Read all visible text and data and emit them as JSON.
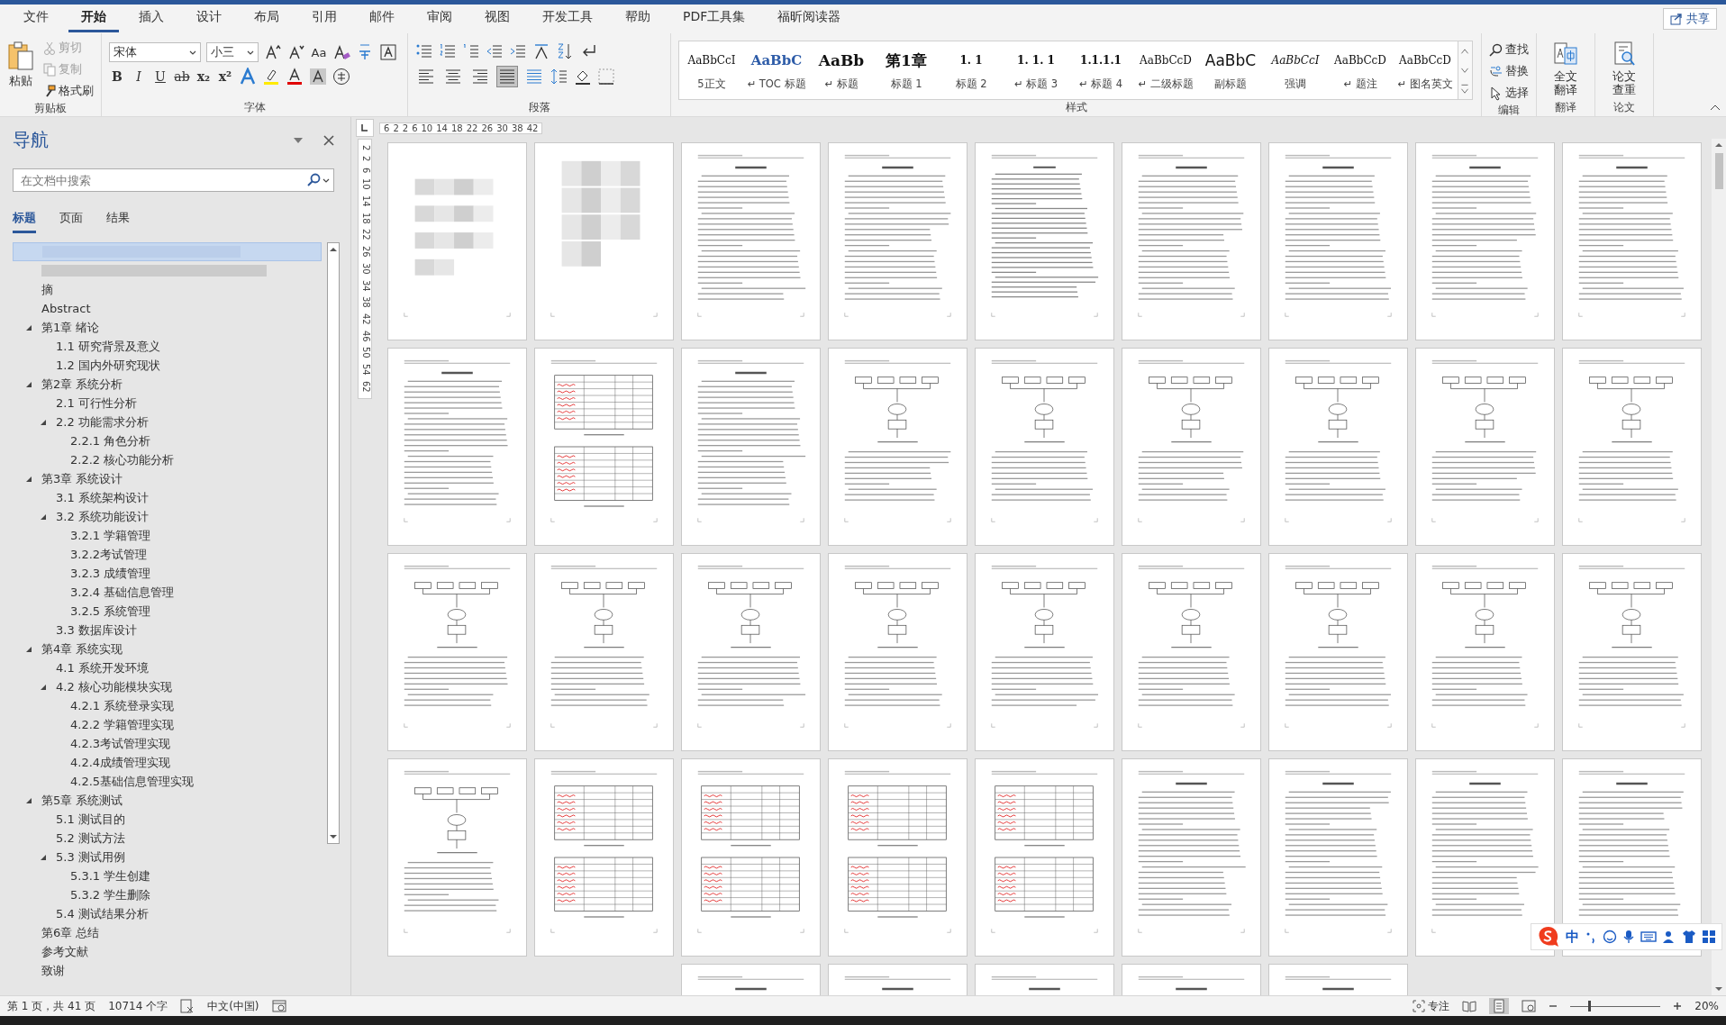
{
  "window": {
    "share_button": "共享"
  },
  "menu_tabs": [
    {
      "label": "文件",
      "selected": false
    },
    {
      "label": "开始",
      "selected": true
    },
    {
      "label": "插入",
      "selected": false
    },
    {
      "label": "设计",
      "selected": false
    },
    {
      "label": "布局",
      "selected": false
    },
    {
      "label": "引用",
      "selected": false
    },
    {
      "label": "邮件",
      "selected": false
    },
    {
      "label": "审阅",
      "selected": false
    },
    {
      "label": "视图",
      "selected": false
    },
    {
      "label": "开发工具",
      "selected": false
    },
    {
      "label": "帮助",
      "selected": false
    },
    {
      "label": "PDF工具集",
      "selected": false
    },
    {
      "label": "福昕阅读器",
      "selected": false
    }
  ],
  "ribbon": {
    "clipboard": {
      "label": "剪贴板",
      "paste": "粘贴",
      "items": [
        {
          "label": "剪切",
          "kind": "cut",
          "disabled": true
        },
        {
          "label": "复制",
          "kind": "copy",
          "disabled": true
        },
        {
          "label": "格式刷",
          "kind": "painter",
          "disabled": false
        }
      ]
    },
    "font": {
      "label": "字体",
      "name": "宋体",
      "size": "小三",
      "case_button": "Aa",
      "buttons": [
        {
          "label": "B",
          "kind": "bold"
        },
        {
          "label": "I",
          "kind": "italic"
        },
        {
          "label": "U",
          "kind": "underline"
        },
        {
          "label": "ab",
          "kind": "strike"
        },
        {
          "label": "x₂",
          "kind": "sub"
        },
        {
          "label": "x²",
          "kind": "sup"
        }
      ]
    },
    "paragraph": {
      "label": "段落",
      "alignments": [
        {
          "kind": "left",
          "selected": false
        },
        {
          "kind": "center",
          "selected": false
        },
        {
          "kind": "right",
          "selected": false
        },
        {
          "kind": "justify",
          "selected": true
        },
        {
          "kind": "distributed",
          "selected": false
        }
      ]
    },
    "styles": {
      "label": "样式",
      "items": [
        {
          "preview": "AaBbCcI",
          "name": "5正文",
          "kind": "normal"
        },
        {
          "preview": "AaBbC",
          "name": "↵ TOC 标题",
          "kind": "toc"
        },
        {
          "preview": "AaBb",
          "name": "↵ 标题",
          "kind": "title"
        },
        {
          "preview": "第1章",
          "name": "标题 1",
          "kind": "title"
        },
        {
          "preview": "1. 1",
          "name": "标题 2",
          "kind": "heading"
        },
        {
          "preview": "1. 1. 1",
          "name": "↵ 标题 3",
          "kind": "heading"
        },
        {
          "preview": "1.1.1.1",
          "name": "↵ 标题 4",
          "kind": "heading"
        },
        {
          "preview": "AaBbCcD",
          "name": "↵ 二级标题",
          "kind": "normal"
        },
        {
          "preview": "AaBbC",
          "name": "副标题",
          "kind": "subtitle"
        },
        {
          "preview": "AaBbCcI",
          "name": "强调",
          "kind": "emphasis"
        },
        {
          "preview": "AaBbCcD",
          "name": "↵ 题注",
          "kind": "normal"
        },
        {
          "preview": "AaBbCcD",
          "name": "↵ 图名英文",
          "kind": "normal"
        }
      ]
    },
    "editing": {
      "label": "编辑",
      "items": [
        {
          "label": "查找",
          "kind": "find"
        },
        {
          "label": "替换",
          "kind": "replace"
        },
        {
          "label": "选择",
          "kind": "select"
        }
      ]
    },
    "translate": {
      "label": "翻译",
      "button": "全文翻译"
    },
    "thesis": {
      "label": "论文",
      "button": "论文查重"
    }
  },
  "navigation": {
    "title": "导航",
    "search": {
      "placeholder": "在文档中搜索"
    },
    "tabs": [
      {
        "label": "标题",
        "selected": true
      },
      {
        "label": "页面",
        "selected": false
      },
      {
        "label": "结果",
        "selected": false
      }
    ],
    "items": [
      {
        "kind": "redacted",
        "selected": true
      },
      {
        "kind": "redacted",
        "selected": false
      },
      {
        "kind": "heading",
        "label": "摘",
        "selected": false
      },
      {
        "kind": "heading",
        "label": "Abstract",
        "selected": false
      },
      {
        "kind": "heading",
        "label": "第1章 绪论",
        "selected": false,
        "expanded": true,
        "children": [
          {
            "kind": "heading",
            "label": "1.1 研究背景及意义",
            "selected": false
          },
          {
            "kind": "heading",
            "label": "1.2 国内外研究现状",
            "selected": false
          }
        ]
      },
      {
        "kind": "heading",
        "label": "第2章 系统分析",
        "selected": false,
        "expanded": true,
        "children": [
          {
            "kind": "heading",
            "label": "2.1 可行性分析",
            "selected": false
          },
          {
            "kind": "heading",
            "label": "2.2 功能需求分析",
            "selected": false,
            "expanded": true,
            "children": [
              {
                "kind": "heading",
                "label": "2.2.1 角色分析",
                "selected": false
              },
              {
                "kind": "heading",
                "label": "2.2.2 核心功能分析",
                "selected": false
              }
            ]
          }
        ]
      },
      {
        "kind": "heading",
        "label": "第3章 系统设计",
        "selected": false,
        "expanded": true,
        "children": [
          {
            "kind": "heading",
            "label": "3.1 系统架构设计",
            "selected": false
          },
          {
            "kind": "heading",
            "label": "3.2 系统功能设计",
            "selected": false,
            "expanded": true,
            "children": [
              {
                "kind": "heading",
                "label": "3.2.1 学籍管理",
                "selected": false
              },
              {
                "kind": "heading",
                "label": "3.2.2考试管理",
                "selected": false
              },
              {
                "kind": "heading",
                "label": "3.2.3 成绩管理",
                "selected": false
              },
              {
                "kind": "heading",
                "label": "3.2.4 基础信息管理",
                "selected": false
              },
              {
                "kind": "heading",
                "label": "3.2.5 系统管理",
                "selected": false
              }
            ]
          },
          {
            "kind": "heading",
            "label": "3.3 数据库设计",
            "selected": false
          }
        ]
      },
      {
        "kind": "heading",
        "label": "第4章 系统实现",
        "selected": false,
        "expanded": true,
        "children": [
          {
            "kind": "heading",
            "label": "4.1 系统开发环境",
            "selected": false
          },
          {
            "kind": "heading",
            "label": "4.2 核心功能模块实现",
            "selected": false,
            "expanded": true,
            "children": [
              {
                "kind": "heading",
                "label": "4.2.1 系统登录实现",
                "selected": false
              },
              {
                "kind": "heading",
                "label": "4.2.2 学籍管理实现",
                "selected": false
              },
              {
                "kind": "heading",
                "label": "4.2.3考试管理实现",
                "selected": false
              },
              {
                "kind": "heading",
                "label": "4.2.4成绩管理实现",
                "selected": false
              },
              {
                "kind": "heading",
                "label": "4.2.5基础信息管理实现",
                "selected": false
              }
            ]
          }
        ]
      },
      {
        "kind": "heading",
        "label": "第5章 系统测试",
        "selected": false,
        "expanded": true,
        "children": [
          {
            "kind": "heading",
            "label": "5.1 测试目的",
            "selected": false
          },
          {
            "kind": "heading",
            "label": "5.2 测试方法",
            "selected": false
          },
          {
            "kind": "heading",
            "label": "5.3 测试用例",
            "selected": false,
            "expanded": true,
            "children": [
              {
                "kind": "heading",
                "label": "5.3.1 学生创建",
                "selected": false
              },
              {
                "kind": "heading",
                "label": "5.3.2 学生删除",
                "selected": false
              }
            ]
          },
          {
            "kind": "heading",
            "label": "5.4 测试结果分析",
            "selected": false
          }
        ]
      },
      {
        "kind": "heading",
        "label": "第6章 总结",
        "selected": false
      },
      {
        "kind": "heading",
        "label": "参考文献",
        "selected": false
      },
      {
        "kind": "heading",
        "label": "致谢",
        "selected": false
      }
    ]
  },
  "rulers": {
    "horizontal": [
      "6",
      "2",
      "2",
      "6",
      "10",
      "14",
      "18",
      "22",
      "26",
      "30",
      "38",
      "42"
    ],
    "vertical": [
      "2",
      "2",
      "6",
      "10",
      "14",
      "18",
      "22",
      "26",
      "30",
      "34",
      "38",
      "42",
      "46",
      "50",
      "54",
      "62"
    ]
  },
  "pages": [
    {
      "kind": "blurred"
    },
    {
      "kind": "blurred"
    },
    {
      "kind": "text"
    },
    {
      "kind": "text"
    },
    {
      "kind": "toc"
    },
    {
      "kind": "text"
    },
    {
      "kind": "text"
    },
    {
      "kind": "text"
    },
    {
      "kind": "text"
    },
    {
      "kind": "text"
    },
    {
      "kind": "table"
    },
    {
      "kind": "text"
    },
    {
      "kind": "diagram"
    },
    {
      "kind": "diagram"
    },
    {
      "kind": "diagram"
    },
    {
      "kind": "diagram"
    },
    {
      "kind": "diagram"
    },
    {
      "kind": "diagram"
    },
    {
      "kind": "diagram"
    },
    {
      "kind": "diagram"
    },
    {
      "kind": "diagram"
    },
    {
      "kind": "diagram"
    },
    {
      "kind": "diagram"
    },
    {
      "kind": "diagram"
    },
    {
      "kind": "diagram"
    },
    {
      "kind": "diagram"
    },
    {
      "kind": "diagram"
    },
    {
      "kind": "diagram"
    },
    {
      "kind": "table"
    },
    {
      "kind": "table"
    },
    {
      "kind": "table"
    },
    {
      "kind": "table"
    },
    {
      "kind": "text"
    },
    {
      "kind": "text"
    },
    {
      "kind": "text"
    },
    {
      "kind": "text"
    },
    {
      "kind": "text"
    },
    {
      "kind": "text"
    },
    {
      "kind": "text"
    },
    {
      "kind": "text"
    },
    {
      "kind": "text"
    }
  ],
  "ime_toolbar": {
    "mode": "中"
  },
  "status_bar": {
    "page": "第 1 页，共 41 页",
    "words": "10714 个字",
    "language": "中文(中国)",
    "focus": "专注",
    "zoom": "20%",
    "zoom_slider": {
      "level": 0.2
    }
  }
}
